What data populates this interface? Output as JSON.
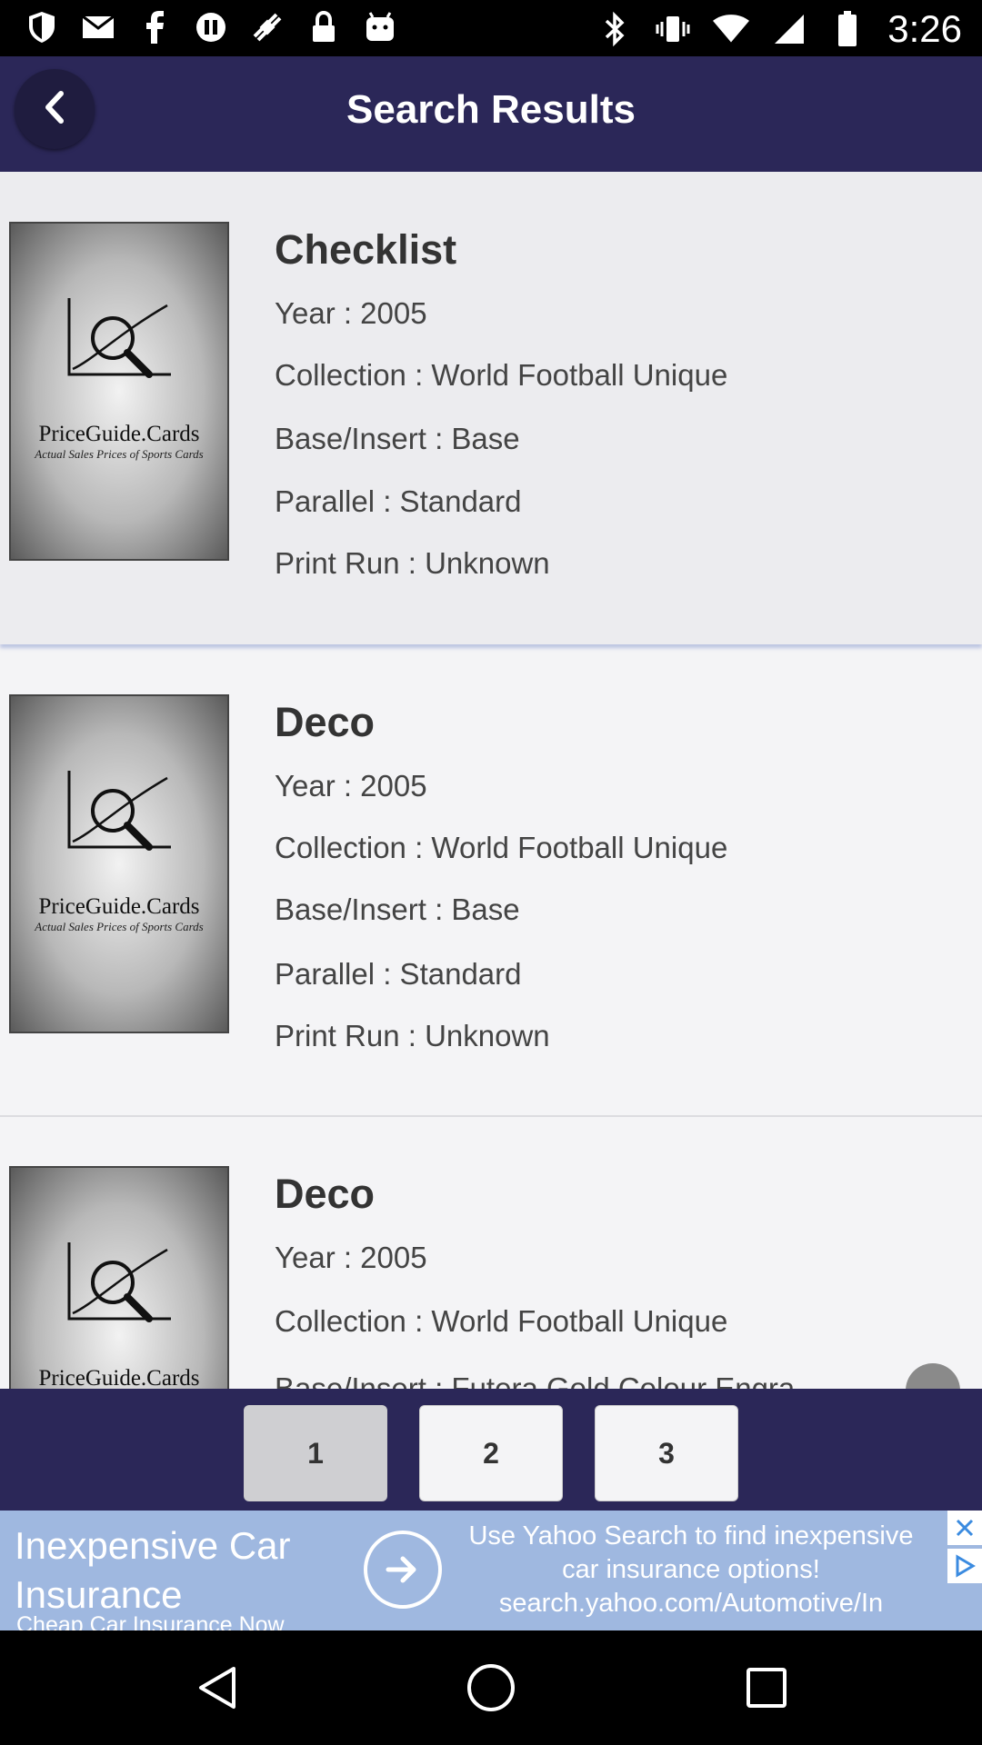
{
  "status_bar": {
    "time": "3:26",
    "left_icons": [
      "shield-icon",
      "mail-icon",
      "facebook-icon",
      "vpn-icon",
      "satellite-icon",
      "lock-icon",
      "android-icon"
    ],
    "right_icons": [
      "bluetooth-icon",
      "vibrate-icon",
      "wifi-icon",
      "signal-icon",
      "battery-icon"
    ]
  },
  "app_bar": {
    "title": "Search Results"
  },
  "thumbnail": {
    "brand": "PriceGuide.Cards",
    "tagline": "Actual Sales Prices of Sports Cards"
  },
  "results": [
    {
      "title": "Checklist",
      "year": "Year : 2005",
      "collection": "Collection : World Football Unique",
      "base_insert": "Base/Insert : Base",
      "parallel": "Parallel : Standard",
      "print_run": "Print Run : Unknown"
    },
    {
      "title": "Deco",
      "year": "Year : 2005",
      "collection": "Collection : World Football Unique",
      "base_insert": "Base/Insert : Base",
      "parallel": "Parallel : Standard",
      "print_run": "Print Run : Unknown"
    },
    {
      "title": "Deco",
      "year": "Year : 2005",
      "collection": "Collection : World Football Unique",
      "base_insert": "Base/Insert : Futera Gold Colour Engra..."
    }
  ],
  "pagination": {
    "pages": [
      "1",
      "2",
      "3"
    ],
    "current": "1"
  },
  "ad": {
    "headline": "Inexpensive Car Insurance",
    "subline": "Cheap Car Insurance Now",
    "body": "Use Yahoo Search to find inexpensive car insurance options!",
    "url": "search.yahoo.com/Automotive/In"
  },
  "colors": {
    "header_bg": "#2b2758",
    "list_bg": "#f4f4f6",
    "ad_bg": "#9fb8e0"
  }
}
